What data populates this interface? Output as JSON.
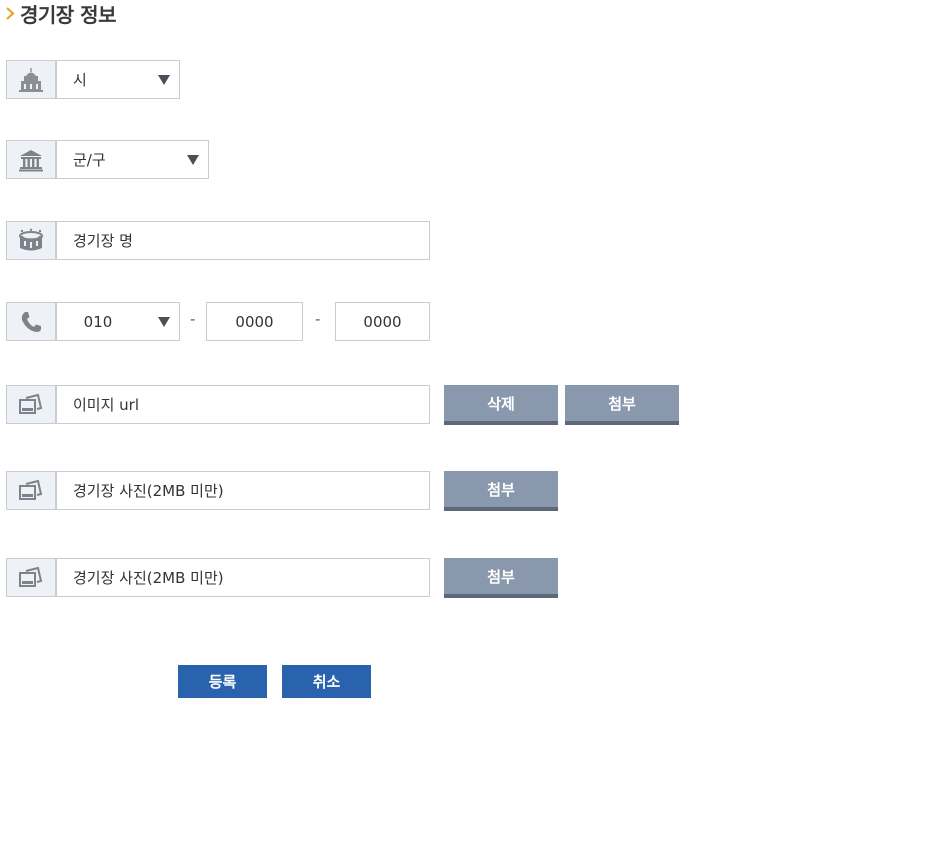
{
  "section": {
    "title": "경기장 정보"
  },
  "city": {
    "value": "시"
  },
  "district": {
    "value": "군/구"
  },
  "stadium_name": {
    "placeholder": "경기장 명"
  },
  "phone": {
    "prefix": "010",
    "middle": "0000",
    "last": "0000",
    "separator": "-"
  },
  "image_url": {
    "placeholder": "이미지 url",
    "delete_label": "삭제",
    "attach_label": "첨부"
  },
  "photo1": {
    "placeholder": "경기장 사진(2MB 미만)",
    "attach_label": "첨부"
  },
  "photo2": {
    "placeholder": "경기장 사진(2MB 미만)",
    "attach_label": "첨부"
  },
  "actions": {
    "register_label": "등록",
    "cancel_label": "취소"
  },
  "colors": {
    "accent_chevron": "#e8a229",
    "button_gray": "#8a98ad",
    "button_blue": "#2a63ad"
  }
}
